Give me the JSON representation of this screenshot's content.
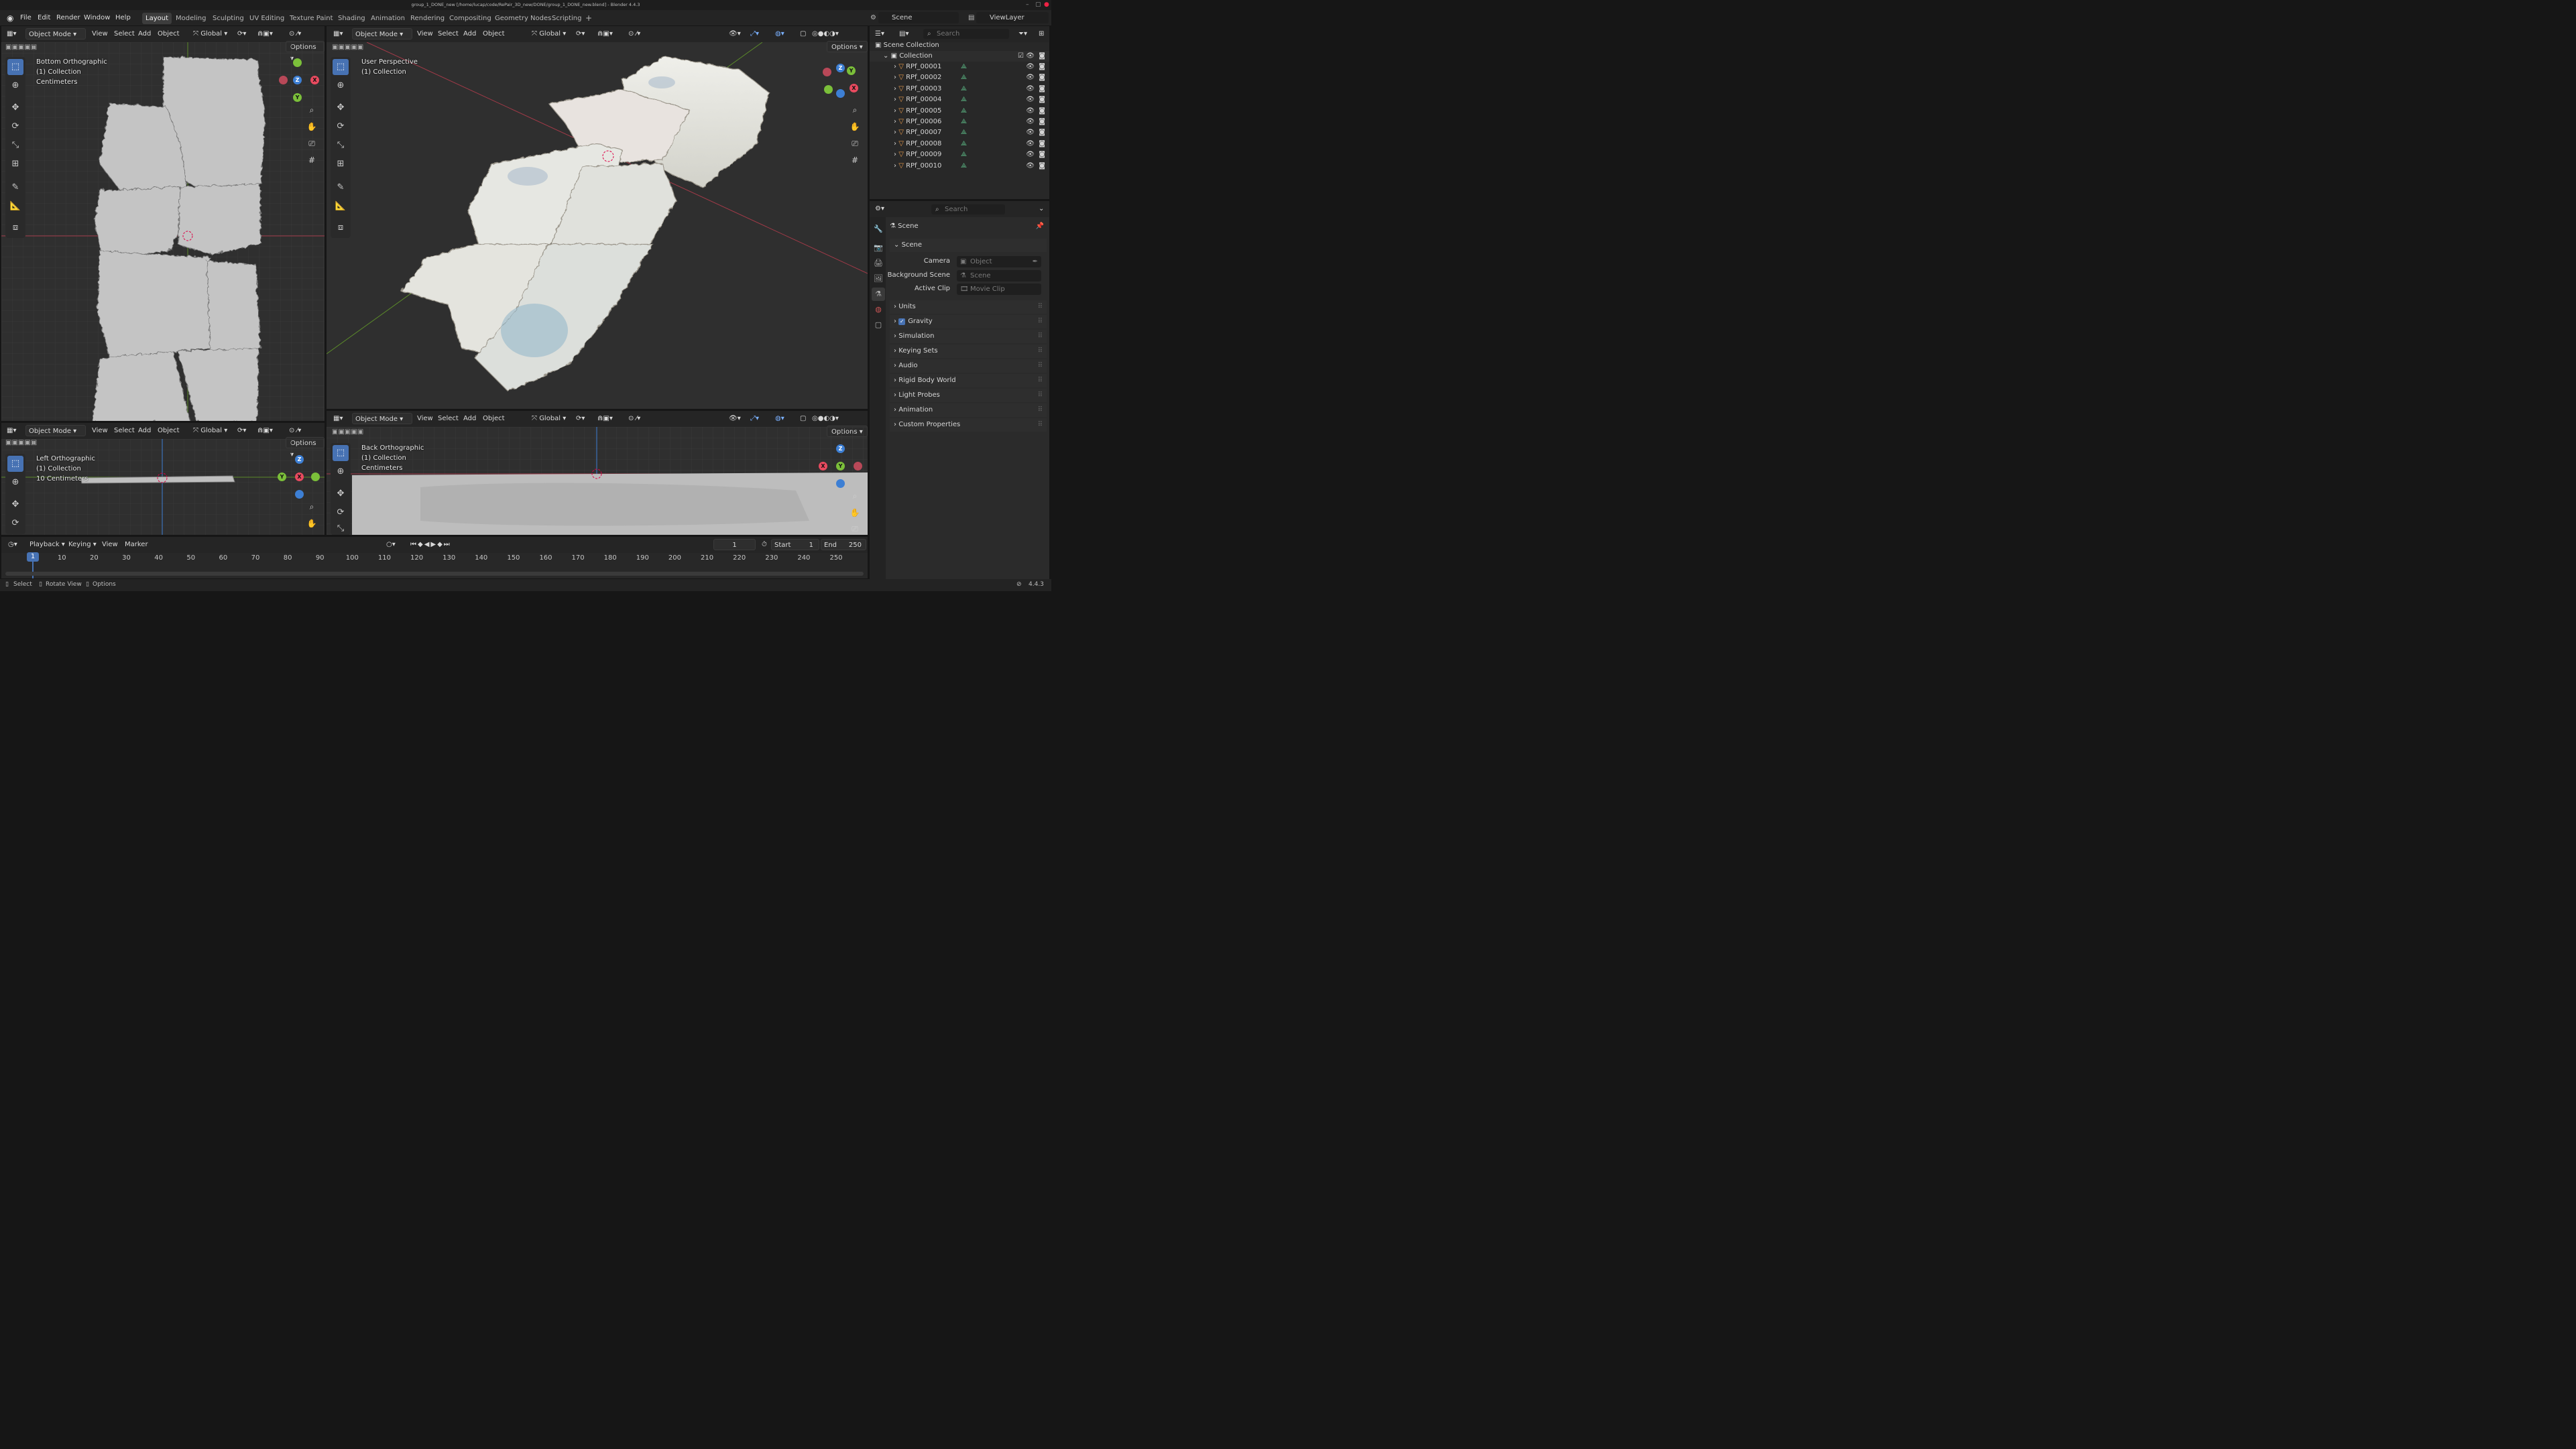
{
  "window": {
    "title": "group_1_DONE_new [/home/lucap/code/RePair_3D_new/DONE/group_1_DONE_new.blend] - Blender 4.4.3"
  },
  "topbar": {
    "menus": [
      "File",
      "Edit",
      "Render",
      "Window",
      "Help"
    ],
    "workspaces": [
      "Layout",
      "Modeling",
      "Sculpting",
      "UV Editing",
      "Texture Paint",
      "Shading",
      "Animation",
      "Rendering",
      "Compositing",
      "Geometry Nodes",
      "Scripting"
    ],
    "active_workspace": "Layout",
    "add_tab": "+",
    "scene": "Scene",
    "view_layer": "ViewLayer"
  },
  "viewport_menus": {
    "mode": "Object Mode",
    "view": "View",
    "select": "Select",
    "add": "Add",
    "object": "Object",
    "orientation": "Global",
    "options": "Options"
  },
  "viewports": {
    "top_left": {
      "name": "Bottom Orthographic",
      "collection": "(1) Collection",
      "units": "Centimeters"
    },
    "center": {
      "name": "User Perspective",
      "collection": "(1) Collection"
    },
    "bottom_left": {
      "name": "Left Orthographic",
      "collection": "(1) Collection",
      "units": "10 Centimeters"
    },
    "bottom_center": {
      "name": "Back Orthographic",
      "collection": "(1) Collection",
      "units": "Centimeters"
    }
  },
  "axes": {
    "x": "X",
    "y": "Y",
    "z": "Z",
    "x_color": "#e84a5f",
    "y_color": "#7bbf3a",
    "z_color": "#3d7fd4"
  },
  "outliner": {
    "search_placeholder": "Search",
    "root": "Scene Collection",
    "collection": "Collection",
    "objects": [
      "RPf_00001",
      "RPf_00002",
      "RPf_00003",
      "RPf_00004",
      "RPf_00005",
      "RPf_00006",
      "RPf_00007",
      "RPf_00008",
      "RPf_00009",
      "RPf_00010"
    ]
  },
  "properties": {
    "search_placeholder": "Search",
    "context": "Scene",
    "panel_title": "Scene",
    "camera_label": "Camera",
    "camera_value": "Object",
    "background_label": "Background Scene",
    "background_value": "Scene",
    "clip_label": "Active Clip",
    "clip_value": "Movie Clip",
    "panels": [
      "Units",
      "Gravity",
      "Simulation",
      "Keying Sets",
      "Audio",
      "Rigid Body World",
      "Light Probes",
      "Animation",
      "Custom Properties"
    ],
    "gravity_checked": true
  },
  "timeline": {
    "menus": [
      "Playback",
      "Keying",
      "View",
      "Marker"
    ],
    "current_frame": "1",
    "start_label": "Start",
    "start": "1",
    "end_label": "End",
    "end": "250",
    "ticks": [
      "1",
      "10",
      "20",
      "30",
      "40",
      "50",
      "60",
      "70",
      "80",
      "90",
      "100",
      "110",
      "120",
      "130",
      "140",
      "150",
      "160",
      "170",
      "180",
      "190",
      "200",
      "210",
      "220",
      "230",
      "240",
      "250"
    ]
  },
  "statusbar": {
    "select": "Select",
    "rotate": "Rotate View",
    "options": "Options",
    "version": "4.4.3"
  },
  "accent": "#4772b3"
}
